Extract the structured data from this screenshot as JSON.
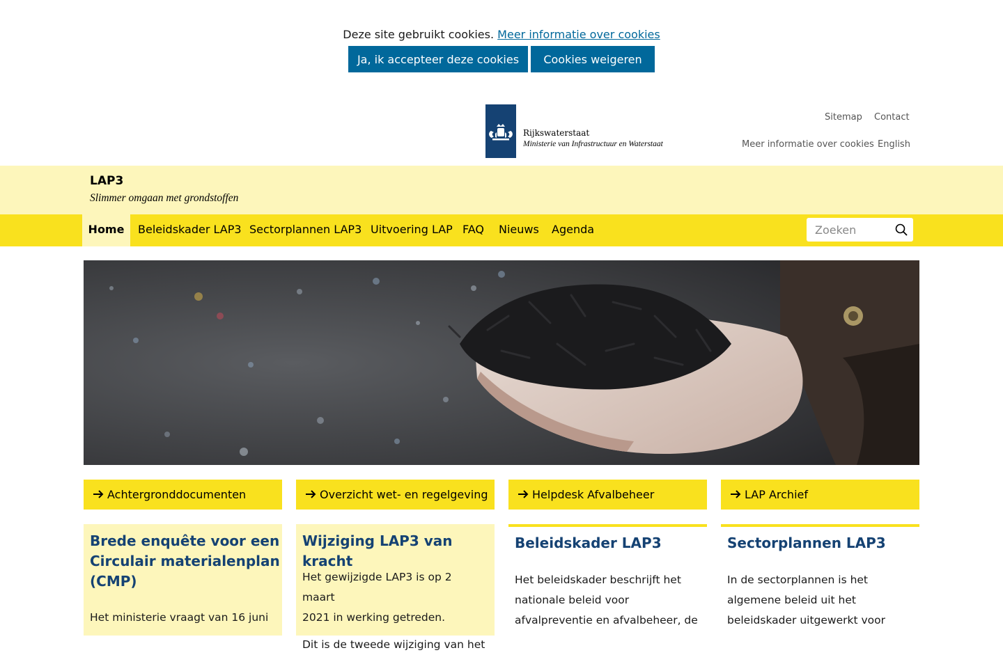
{
  "cookie": {
    "message": "Deze site gebruikt cookies.",
    "more_link": "Meer informatie over cookies",
    "accept_label": "Ja, ik accepteer deze cookies",
    "refuse_label": "Cookies weigeren"
  },
  "logo": {
    "line1": "Rijkswaterstaat",
    "line2": "Ministerie van Infrastructuur en Waterstaat"
  },
  "service_links": [
    "Sitemap",
    "Contact",
    "Meer informatie over cookies",
    "English"
  ],
  "site": {
    "title": "LAP3",
    "subtitle": "Slimmer omgaan met grondstoffen"
  },
  "nav": {
    "items": [
      "Home",
      "Beleidskader LAP3",
      "Sectorplannen LAP3",
      "Uitvoering LAP",
      "FAQ",
      "Nieuws",
      "Agenda"
    ],
    "active": "Home"
  },
  "search": {
    "placeholder": "Zoeken"
  },
  "quick_links": [
    "Achtergronddocumenten",
    "Overzicht wet- en regelgeving",
    "Helpdesk Afvalbeheer",
    "LAP Archief"
  ],
  "cards": [
    {
      "title_lines": [
        "Brede enquête voor een",
        "Circulair materialenplan",
        "(CMP)"
      ],
      "text_lines": [
        "Het ministerie vraagt van 16 juni"
      ]
    },
    {
      "title_lines": [
        "Wijziging LAP3 van kracht"
      ],
      "text_lines": [
        "Het gewijzigde LAP3 is op 2 maart",
        "2021 in werking getreden.",
        "Dit is de tweede wijziging van het"
      ]
    },
    {
      "title_lines": [
        "Beleidskader LAP3"
      ],
      "text_lines": [
        "Het beleidskader beschrijft het",
        "nationale beleid voor",
        "afvalpreventie en afvalbeheer, de"
      ]
    },
    {
      "title_lines": [
        "Sectorplannen LAP3"
      ],
      "text_lines": [
        "In de sectorplannen is het",
        "algemene beleid uit het",
        "beleidskader uitgewerkt voor"
      ]
    }
  ],
  "colors": {
    "brand_blue": "#01689b",
    "dark_blue": "#154273",
    "yellow": "#f9e11e",
    "light_yellow": "#fdf6bb"
  }
}
